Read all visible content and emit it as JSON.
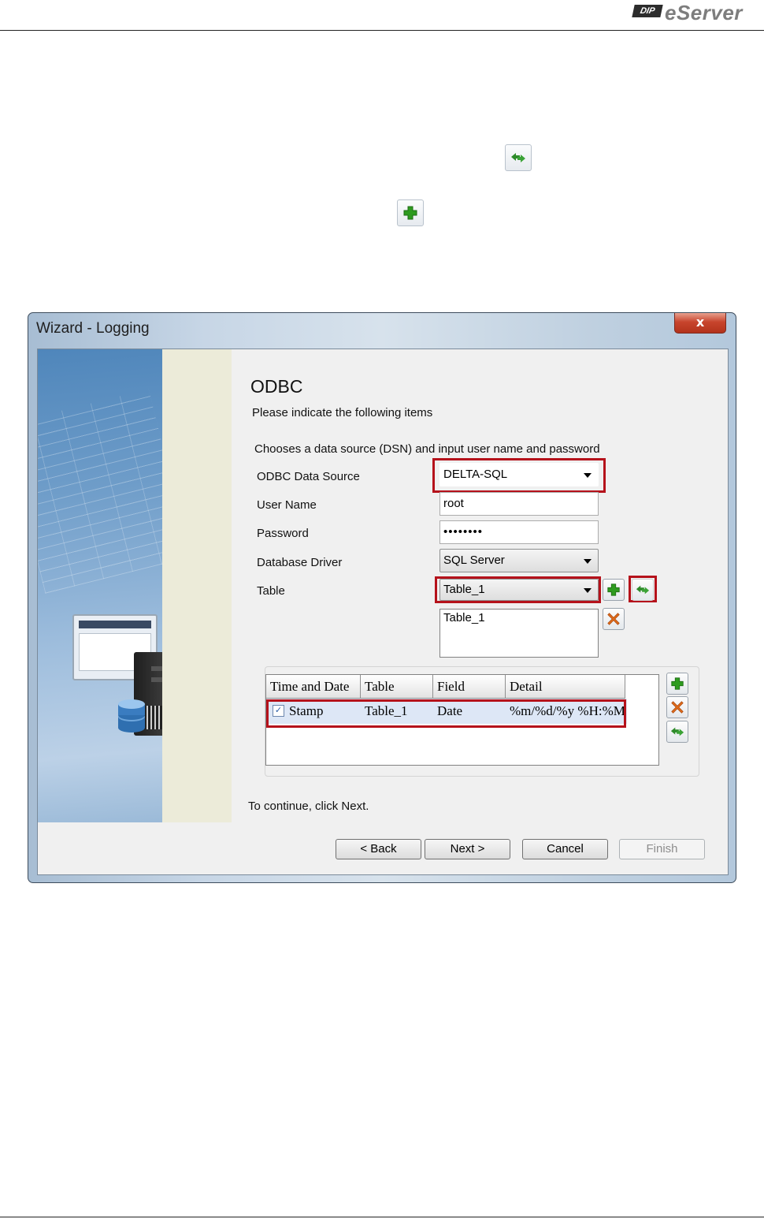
{
  "header": {
    "logo_badge": "DIP",
    "logo_text": "eServer"
  },
  "dialog": {
    "title": "Wizard - Logging",
    "close_glyph": "x",
    "heading": "ODBC",
    "subheading": "Please indicate the following items",
    "instruction": "Chooses a data source (DSN) and input user name and password",
    "fields": {
      "data_source": {
        "label": "ODBC Data Source",
        "value": "DELTA-SQL"
      },
      "user_name": {
        "label": "User Name",
        "value": "root"
      },
      "password": {
        "label": "Password",
        "value": "••••••••"
      },
      "driver": {
        "label": "Database Driver",
        "value": "SQL Server"
      },
      "table": {
        "label": "Table",
        "value": "Table_1"
      }
    },
    "table_list": [
      "Table_1"
    ],
    "grid": {
      "columns": [
        "Time and Date",
        "Table",
        "Field",
        "Detail"
      ],
      "rows": [
        {
          "checked": true,
          "name": "Stamp",
          "table": "Table_1",
          "field": "Date",
          "detail": "%m/%d/%y %H:%M"
        }
      ]
    },
    "continue_text": "To continue, click Next.",
    "buttons": {
      "back": "< Back",
      "next": "Next >",
      "cancel": "Cancel",
      "finish": "Finish"
    }
  },
  "icons": {
    "add": "plus-icon",
    "delete": "x-icon",
    "refresh": "refresh-icon"
  },
  "colors": {
    "highlight_border": "#b5121b",
    "add_green": "#2e9b1f",
    "delete_orange": "#e06b1a"
  }
}
